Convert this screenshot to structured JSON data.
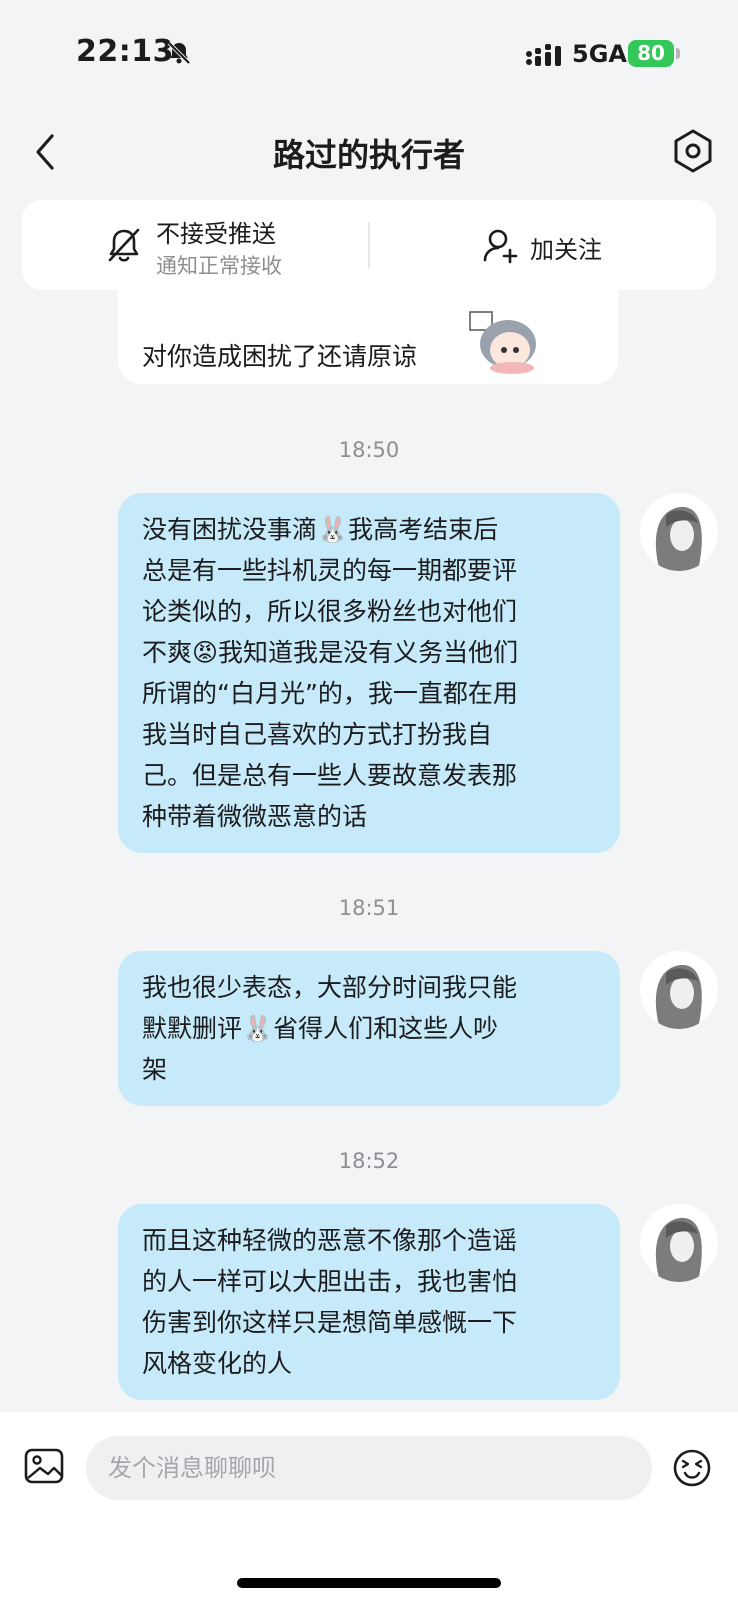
{
  "status_bar": {
    "time": "22:13",
    "network": "5GA",
    "battery": "80"
  },
  "header": {
    "title": "路过的执行者"
  },
  "actions": {
    "mute_label": "不接受推送",
    "mute_sub": "通知正常接收",
    "follow_label": "加关注"
  },
  "messages": [
    {
      "side": "left",
      "text": "对你造成困扰了还请原谅",
      "sticker": "cartoon-character-sticker"
    },
    {
      "side": "right",
      "time": "18:50",
      "text": "没有困扰没事滴🐰我高考结束后\n总是有一些抖机灵的每一期都要评\n论类似的，所以很多粉丝也对他们\n不爽😡我知道我是没有义务当他们\n所谓的“白月光”的，我一直都在用\n我当时自己喜欢的方式打扮我自\n己。但是总有一些人要故意发表那\n种带着微微恶意的话"
    },
    {
      "side": "right",
      "time": "18:51",
      "text": "我也很少表态，大部分时间我只能\n默默删评🐰省得人们和这些人吵\n架"
    },
    {
      "side": "right",
      "time": "18:52",
      "text": "而且这种轻微的恶意不像那个造谣\n的人一样可以大胆出击，我也害怕\n伤害到你这样只是想简单感慨一下\n风格变化的人"
    }
  ],
  "composer": {
    "placeholder": "发个消息聊聊呗"
  },
  "colors": {
    "background": "#f3f4f6",
    "right_bubble": "#c6eaf9",
    "left_bubble": "#ffffff",
    "battery": "#34c759"
  }
}
